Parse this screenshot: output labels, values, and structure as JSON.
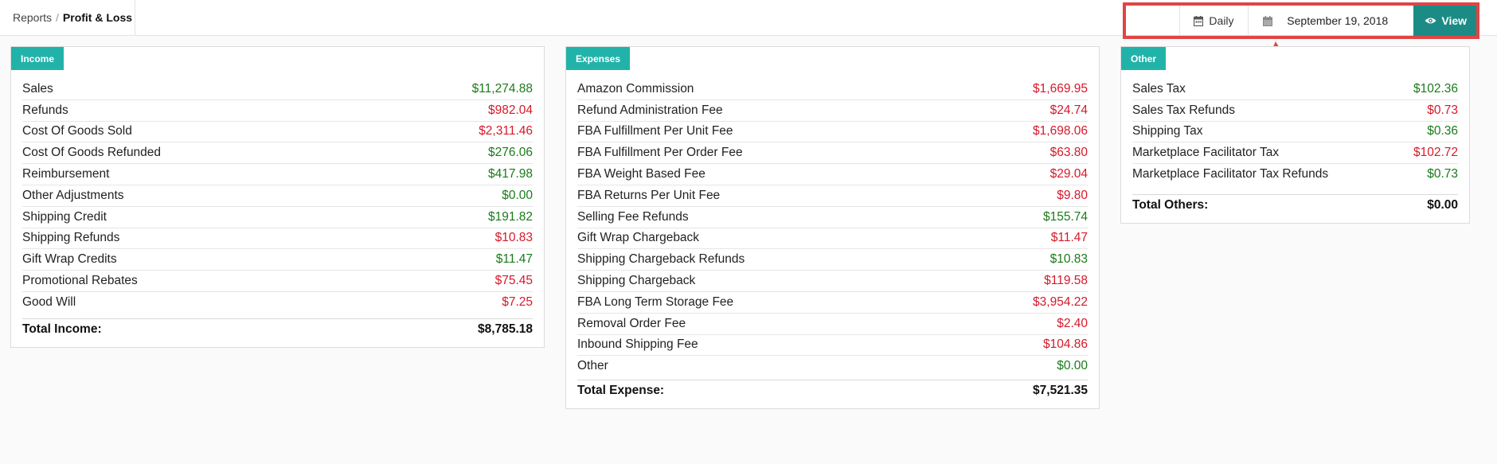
{
  "breadcrumb": {
    "root": "Reports",
    "separator": "/",
    "current": "Profit & Loss"
  },
  "toolbar": {
    "period_label": "Daily",
    "date_value": "September 19, 2018",
    "view_label": "View"
  },
  "income": {
    "tag": "Income",
    "rows": [
      {
        "label": "Sales",
        "value": "$11,274.88",
        "sign": "pos"
      },
      {
        "label": "Refunds",
        "value": "$982.04",
        "sign": "neg"
      },
      {
        "label": "Cost Of Goods Sold",
        "value": "$2,311.46",
        "sign": "neg"
      },
      {
        "label": "Cost Of Goods Refunded",
        "value": "$276.06",
        "sign": "pos"
      },
      {
        "label": "Reimbursement",
        "value": "$417.98",
        "sign": "pos"
      },
      {
        "label": "Other Adjustments",
        "value": "$0.00",
        "sign": "pos"
      },
      {
        "label": "Shipping Credit",
        "value": "$191.82",
        "sign": "pos"
      },
      {
        "label": "Shipping Refunds",
        "value": "$10.83",
        "sign": "neg"
      },
      {
        "label": "Gift Wrap Credits",
        "value": "$11.47",
        "sign": "pos"
      },
      {
        "label": "Promotional Rebates",
        "value": "$75.45",
        "sign": "neg"
      },
      {
        "label": "Good Will",
        "value": "$7.25",
        "sign": "neg"
      }
    ],
    "total_label": "Total Income:",
    "total_value": "$8,785.18"
  },
  "expenses": {
    "tag": "Expenses",
    "rows": [
      {
        "label": "Amazon Commission",
        "value": "$1,669.95",
        "sign": "neg"
      },
      {
        "label": "Refund Administration Fee",
        "value": "$24.74",
        "sign": "neg"
      },
      {
        "label": "FBA Fulfillment Per Unit Fee",
        "value": "$1,698.06",
        "sign": "neg"
      },
      {
        "label": "FBA Fulfillment Per Order Fee",
        "value": "$63.80",
        "sign": "neg"
      },
      {
        "label": "FBA Weight Based Fee",
        "value": "$29.04",
        "sign": "neg"
      },
      {
        "label": "FBA Returns Per Unit Fee",
        "value": "$9.80",
        "sign": "neg"
      },
      {
        "label": "Selling Fee Refunds",
        "value": "$155.74",
        "sign": "pos"
      },
      {
        "label": "Gift Wrap Chargeback",
        "value": "$11.47",
        "sign": "neg"
      },
      {
        "label": "Shipping Chargeback Refunds",
        "value": "$10.83",
        "sign": "pos"
      },
      {
        "label": "Shipping Chargeback",
        "value": "$119.58",
        "sign": "neg"
      },
      {
        "label": "FBA Long Term Storage Fee",
        "value": "$3,954.22",
        "sign": "neg"
      },
      {
        "label": "Removal Order Fee",
        "value": "$2.40",
        "sign": "neg"
      },
      {
        "label": "Inbound Shipping Fee",
        "value": "$104.86",
        "sign": "neg"
      },
      {
        "label": "Other",
        "value": "$0.00",
        "sign": "pos"
      }
    ],
    "total_label": "Total Expense:",
    "total_value": "$7,521.35"
  },
  "other": {
    "tag": "Other",
    "rows": [
      {
        "label": "Sales Tax",
        "value": "$102.36",
        "sign": "pos"
      },
      {
        "label": "Sales Tax Refunds",
        "value": "$0.73",
        "sign": "neg"
      },
      {
        "label": "Shipping Tax",
        "value": "$0.36",
        "sign": "pos"
      },
      {
        "label": "Marketplace Facilitator Tax",
        "value": "$102.72",
        "sign": "neg"
      },
      {
        "label": "Marketplace Facilitator Tax Refunds",
        "value": "$0.73",
        "sign": "pos"
      }
    ],
    "total_label": "Total Others:",
    "total_value": "$0.00"
  },
  "colors": {
    "positive": "#1b7a1b",
    "negative": "#d6192a",
    "accent": "#21b3aa",
    "view_button": "#1c8b85",
    "annotation": "#e04545"
  },
  "icons": {
    "period": "calendar-icon",
    "date": "calendar-icon",
    "view": "eye-icon"
  }
}
